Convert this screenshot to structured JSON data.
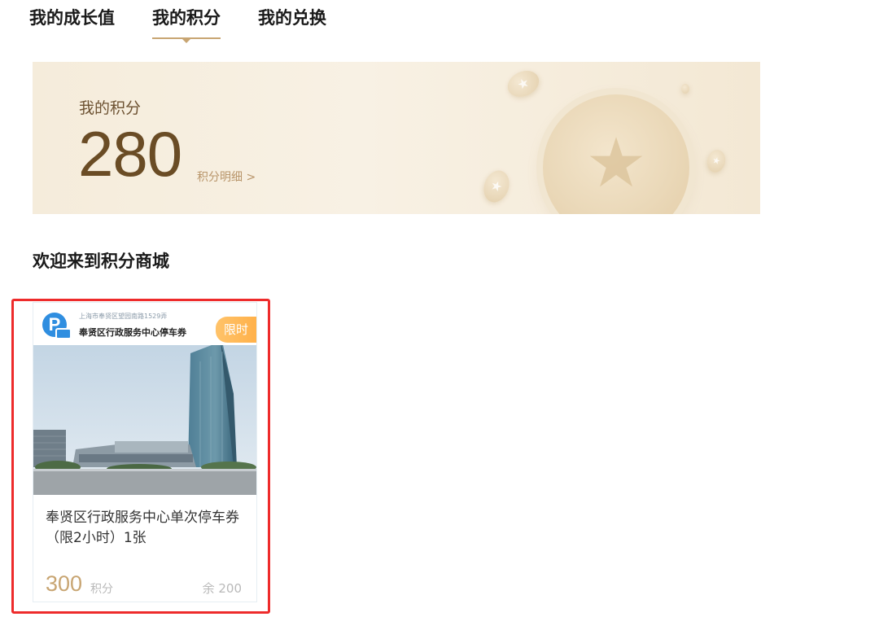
{
  "tabs": [
    {
      "label": "我的成长值",
      "active": false
    },
    {
      "label": "我的积分",
      "active": true
    },
    {
      "label": "我的兑换",
      "active": false
    }
  ],
  "points": {
    "label": "我的积分",
    "value": "280",
    "detail_link": "积分明细 >"
  },
  "section_title": "欢迎来到积分商城",
  "products": [
    {
      "image_header": {
        "address": "上海市奉贤区望园南路1529弄",
        "ticket_name": "奉贤区行政服务中心停车券",
        "tag": "限时"
      },
      "title": "奉贤区行政服务中心单次停车券（限2小时）1张",
      "price": "300",
      "price_unit": "积分",
      "stock": "余 200"
    }
  ],
  "colors": {
    "accent": "#c8a572",
    "highlight": "#ee2b2b",
    "tag": "#ffb14a",
    "logo_blue": "#2f8ee0"
  },
  "icons": {
    "parking": "parking-icon",
    "coin": "coin-icon"
  }
}
